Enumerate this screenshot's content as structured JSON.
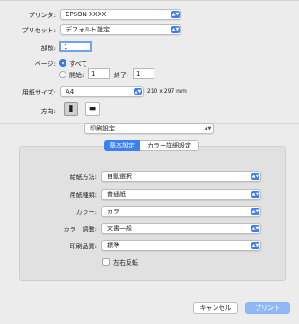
{
  "printer": {
    "label": "プリンタ:",
    "value": "EPSON XXXX"
  },
  "preset": {
    "label": "プリセット:",
    "value": "デフォルト設定"
  },
  "copies": {
    "label": "部数:",
    "value": "1"
  },
  "pages": {
    "label": "ページ:",
    "all_label": "すべて",
    "start_label": "開始:",
    "start_value": "1",
    "end_label": "終了:",
    "end_value": "1"
  },
  "paper_size": {
    "label": "用紙サイズ:",
    "value": "A4",
    "dimensions": "210 x 297 mm"
  },
  "orientation": {
    "label": "方向:"
  },
  "section": {
    "value": "印刷設定"
  },
  "tabs": [
    {
      "label": "基本設定",
      "active": true
    },
    {
      "label": "カラー詳細設定",
      "active": false
    }
  ],
  "settings": {
    "feed": {
      "label": "給紙方法:",
      "value": "自動選択"
    },
    "media": {
      "label": "用紙種類:",
      "value": "普通紙"
    },
    "color": {
      "label": "カラー:",
      "value": "カラー"
    },
    "color_adjust": {
      "label": "カラー調整:",
      "value": "文書一般"
    },
    "quality": {
      "label": "印刷品質:",
      "value": "標準"
    },
    "mirror": {
      "label": "左右反転",
      "checked": false
    }
  },
  "buttons": {
    "cancel": "キャンセル",
    "print": "プリント"
  },
  "colors": {
    "accent": "#3b7ff2",
    "print_disabled": "#8fb8f7"
  }
}
